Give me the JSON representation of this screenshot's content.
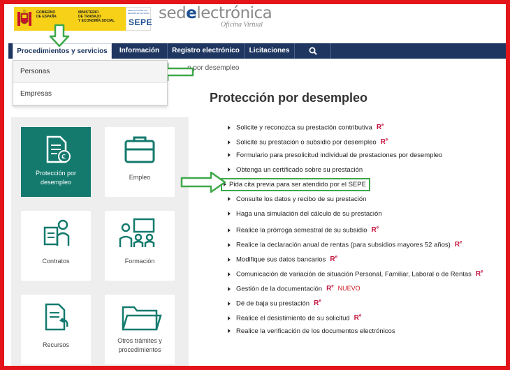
{
  "header": {
    "gov_lines": [
      "GOBIERNO",
      "DE ESPAÑA"
    ],
    "ministry_lines": [
      "MINISTERIO",
      "DE TRABAJO",
      "Y ECONOMÍA SOCIAL"
    ],
    "sepe_small_lines": [
      "SERVICIO PÚBLICO",
      "DE EMPLEO ESTATAL"
    ],
    "sepe_logo": "SEPE",
    "sede_prefix": "sed",
    "sede_e": "e",
    "sede_suffix": "lectrónica",
    "sede_sub": "Oficina Virtual"
  },
  "nav": {
    "items": [
      "Procedimientos y servicios",
      "Información",
      "Registro electrónico",
      "Licitaciones"
    ],
    "search_icon": "search-icon"
  },
  "dropdown": {
    "items": [
      "Personas",
      "Empresas"
    ]
  },
  "breadcrumb": "n por desempleo",
  "tiles": [
    {
      "label": "Protección por desempleo",
      "icon": "document-euro-icon"
    },
    {
      "label": "Empleo",
      "icon": "briefcase-icon"
    },
    {
      "label": "Contratos",
      "icon": "contract-person-icon"
    },
    {
      "label": "Formación",
      "icon": "classroom-icon"
    },
    {
      "label": "Recursos",
      "icon": "document-reply-icon"
    },
    {
      "label": "Otros trámites y procedimientos",
      "icon": "folder-icon"
    }
  ],
  "main": {
    "title": "Protección por desempleo",
    "re_mark": "R",
    "re_sup": "e",
    "nuevo": "NUEVO",
    "items": [
      "Solicite y reconozca su prestación contributiva",
      "Solicite su prestación o subsidio por desempleo",
      "Formulario para presolicitud individual de prestaciones por desempleo",
      "Obtenga un certificado sobre su prestación",
      "Pida cita previa para ser atendido por el SEPE",
      "Consulte los datos y recibo de su prestación",
      "Haga una simulación del cálculo de su prestación",
      "Realice la prórroga semestral de su subsidio",
      "Realice la declaración anual de rentas (para subsidios mayores 52 años)",
      "Modifique sus datos bancarios",
      "Comunicación de variación de situación Personal, Familiar, Laboral o de Rentas",
      "Gestión de la documentación",
      "Dé de baja su prestación",
      "Realice el desistimiento de su solicitud",
      "Realice la verificación de los documentos electrónicos"
    ]
  },
  "colors": {
    "frame": "#e3151a",
    "nav": "#1f3760",
    "tile_active": "#147a6e",
    "icon": "#147a6e",
    "arrow": "#3ea84a",
    "re": "#c4163f"
  }
}
